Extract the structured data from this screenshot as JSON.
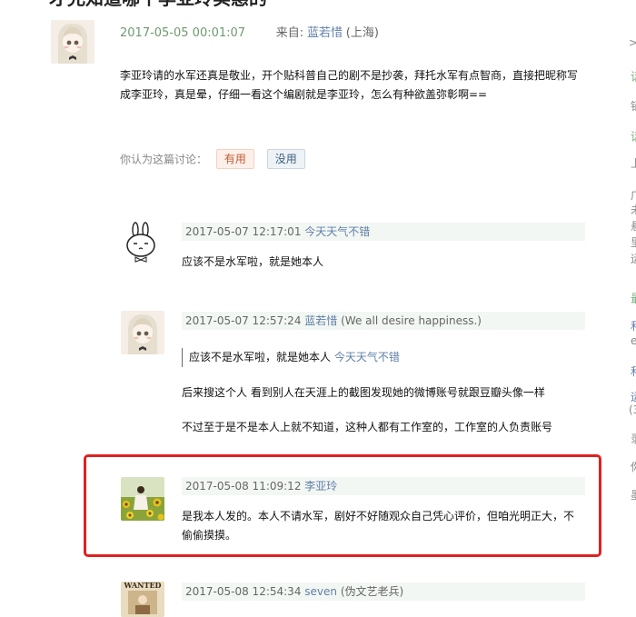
{
  "page": {
    "title_fragment": "才允知道哪个李亚玲实惠的"
  },
  "main_review": {
    "time": "2017-05-05 00:01:07",
    "from_label": "来自:",
    "author": "蓝若惜",
    "location": "(上海)",
    "content": "李亚玲请的水军还真是敬业，开个贴科普自己的剧不是抄袭，拜托水军有点智商，直接把昵称写成李亚玲，真是晕，仔细一看这个编剧就是李亚玲，怎么有种欲盖弥彰啊==",
    "vote_prompt": "你认为这篇讨论：",
    "useful_label": "有用",
    "useless_label": "没用"
  },
  "replies": [
    {
      "time": "2017-05-07 12:17:01",
      "author": "今天天气不错",
      "author_note": "",
      "paragraphs": [
        "应该不是水军啦，就是她本人"
      ]
    },
    {
      "time": "2017-05-07 12:57:24",
      "author": "蓝若惜",
      "author_note": "(We all desire happiness.)",
      "quote_text": "应该不是水军啦，就是她本人",
      "quote_author": "今天天气不错",
      "paragraphs": [
        "后来搜这个人 看到别人在天涯上的截图发现她的微博账号就跟豆瓣头像一样",
        "不过至于是不是本人上就不知道，这种人都有工作室的，工作室的人负责账号"
      ]
    },
    {
      "time": "2017-05-08 11:09:12",
      "author": "李亚玲",
      "author_note": "",
      "paragraphs": [
        "是我本人发的。本人不请水军，剧好不好随观众自己凭心评价，但咱光明正大，不偷偷摸摸。"
      ]
    },
    {
      "time": "2017-05-08 12:54:34",
      "author": "seven",
      "author_note": "(伪文艺老兵)"
    }
  ],
  "avatar_texts": {
    "wanted": "WANTED"
  },
  "sidebar_fragments": [
    ">",
    "话",
    "销",
    "话",
    "上",
    "广",
    "未",
    "悬",
    "里",
    "运",
    "最",
    "和",
    "e",
    "和",
    "运",
    "(3",
    "录",
    "你",
    "墨"
  ],
  "colors": {
    "highlight": "#e02020",
    "link": "#5f7fa8",
    "time_green": "#6f9a6f"
  }
}
